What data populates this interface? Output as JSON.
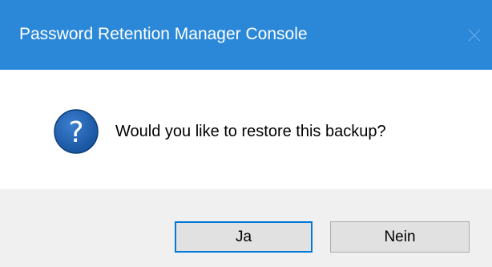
{
  "window": {
    "title": "Password Retention Manager Console",
    "close_icon": "close-icon"
  },
  "content": {
    "icon": "question-icon",
    "icon_color": "#1c5aa6",
    "message": "Would you like to restore this backup?"
  },
  "buttons": {
    "yes_label": "Ja",
    "no_label": "Nein",
    "default": "yes"
  },
  "colors": {
    "titlebar": "#2b88d8",
    "footer": "#f0f0f0",
    "default_border": "#0078d7"
  }
}
